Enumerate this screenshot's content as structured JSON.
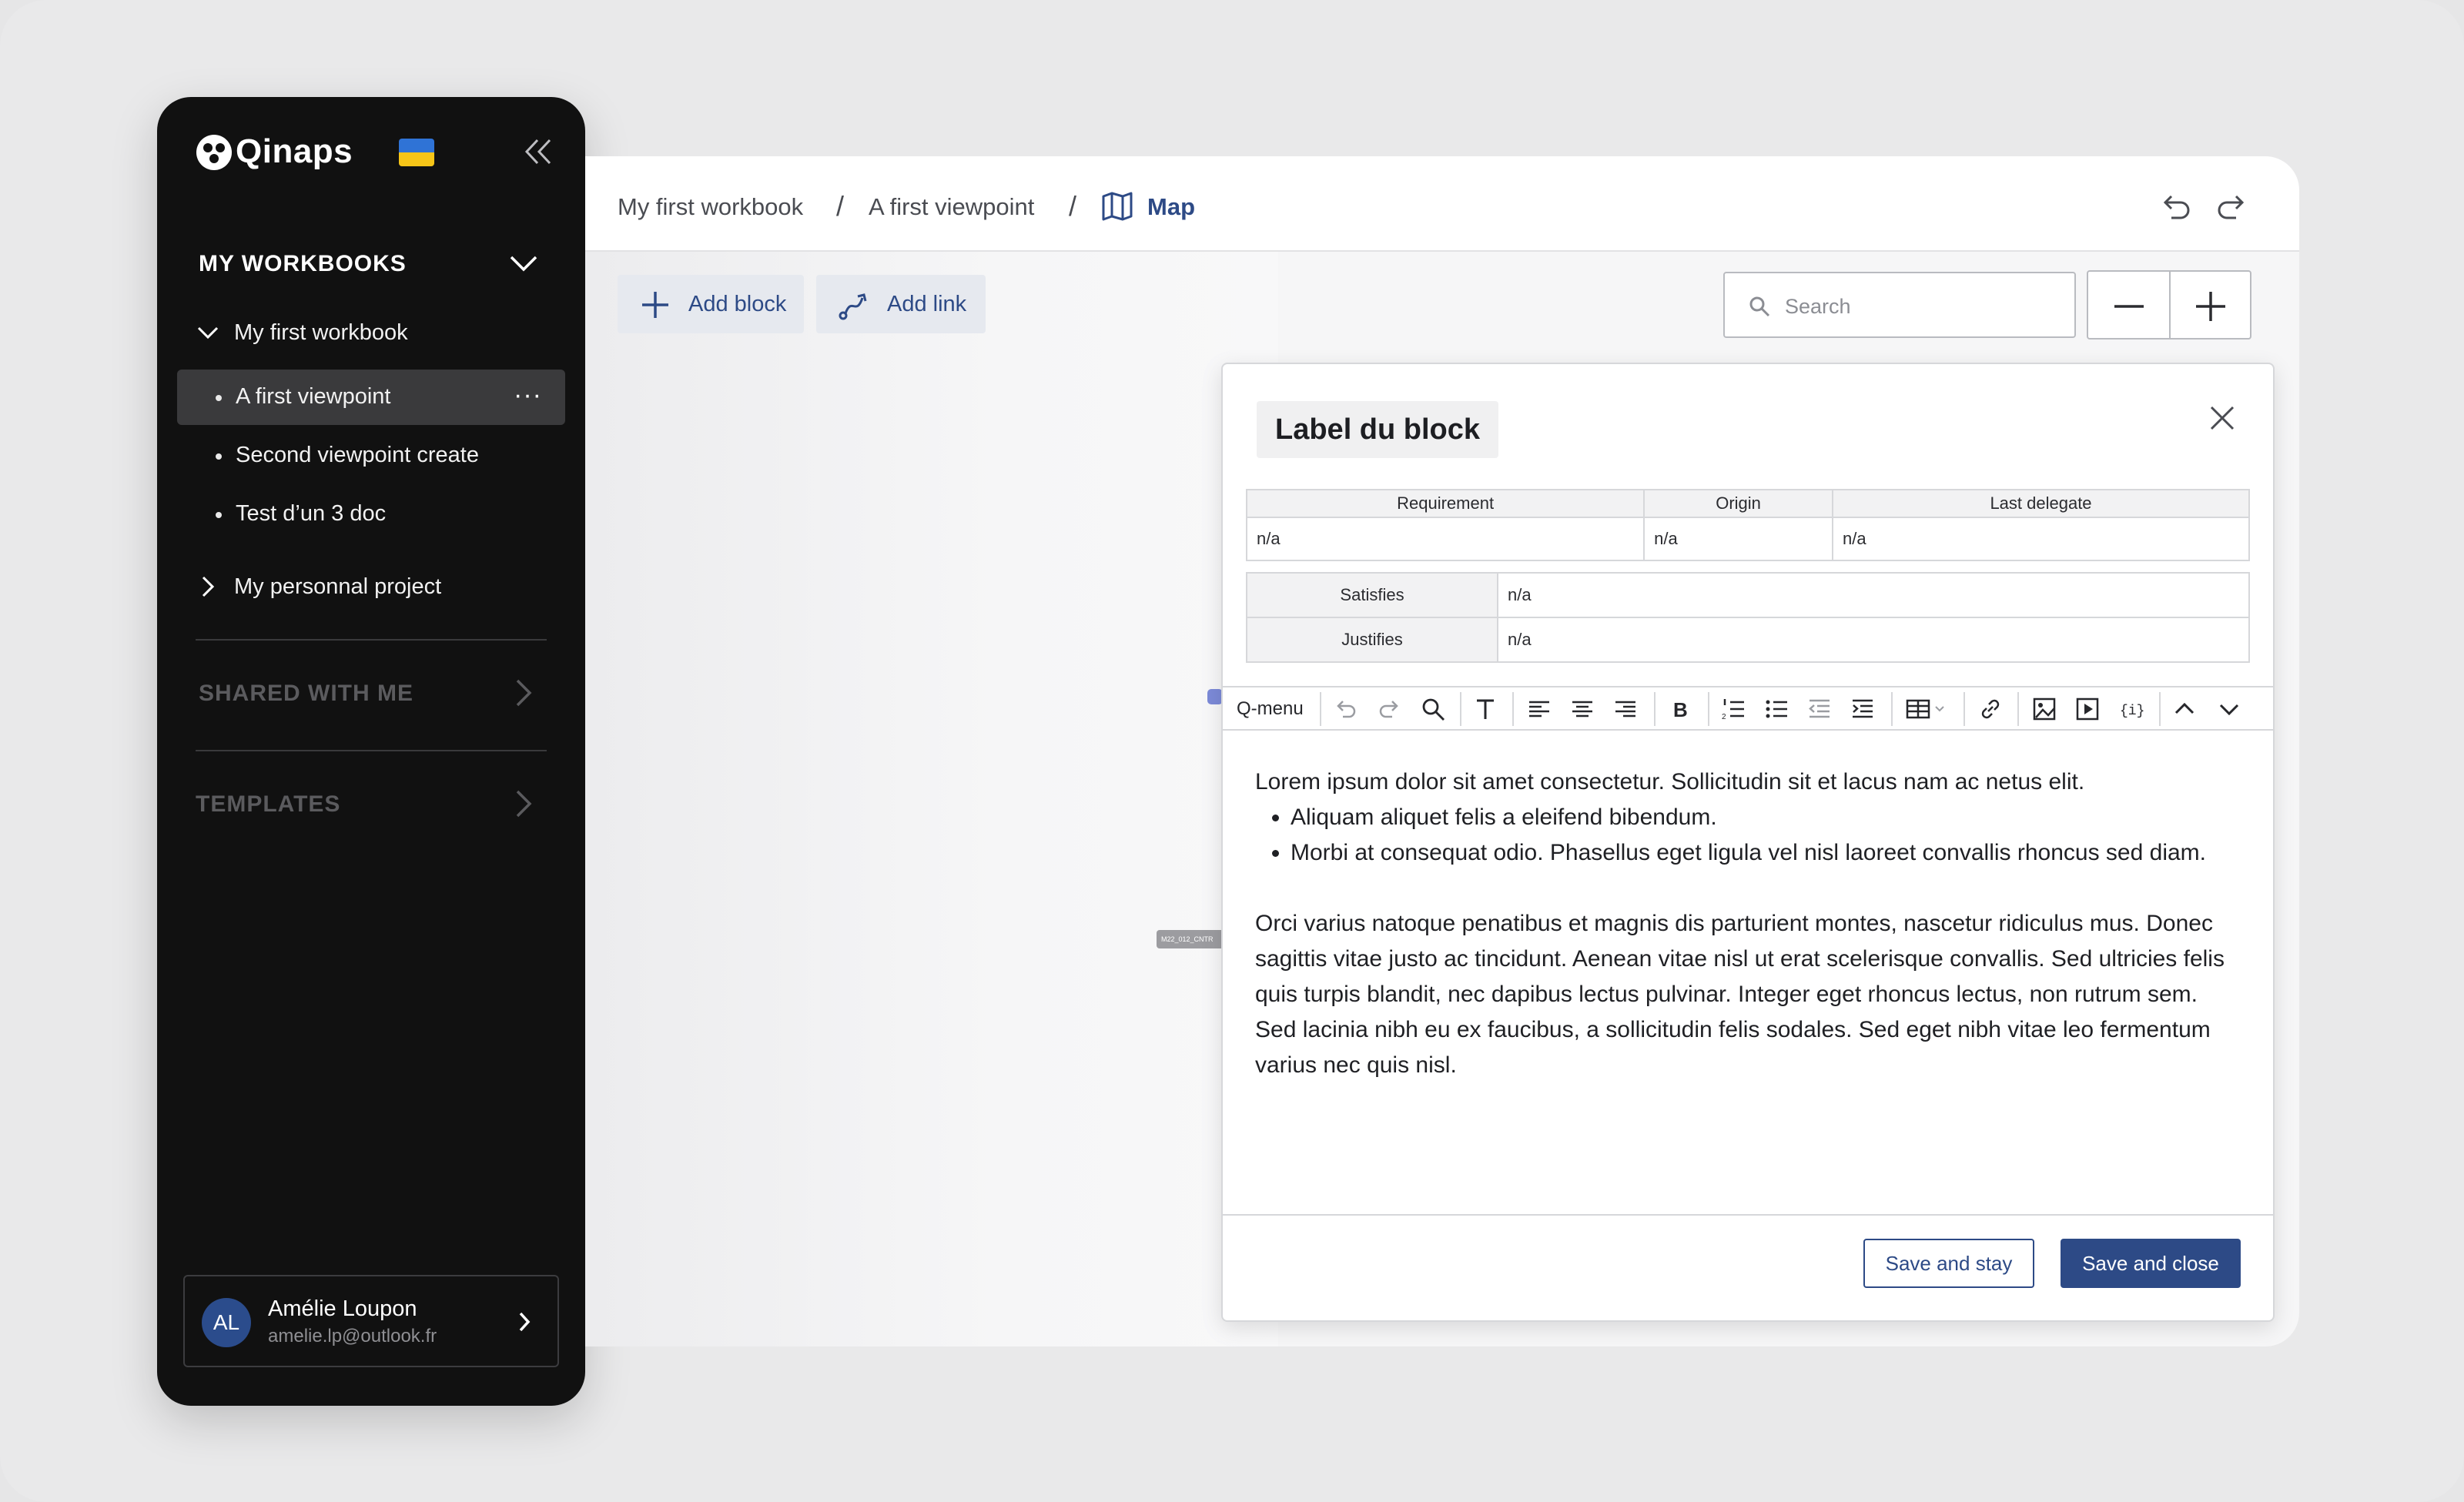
{
  "app": {
    "name": "Qinaps",
    "flag_icon": "ukraine-flag-icon"
  },
  "sidebar": {
    "collapse_icon": "double-chevron-left-icon",
    "my_workbooks": "MY WORKBOOKS",
    "workbooks": [
      {
        "label": "My first workbook",
        "expanded": true,
        "viewpoints": [
          {
            "label": "A first viewpoint",
            "active": true,
            "more": "···"
          },
          {
            "label": "Second viewpoint create"
          },
          {
            "label": "Test d’un 3 doc"
          }
        ]
      },
      {
        "label": "My personnal project",
        "expanded": false
      }
    ],
    "shared_with_me": "SHARED WITH ME",
    "templates": "TEMPLATES",
    "user": {
      "initials": "AL",
      "name": "Amélie Loupon",
      "email": "amelie.lp@outlook.fr"
    }
  },
  "breadcrumb": {
    "workbook": "My first workbook",
    "viewpoint": "A first viewpoint",
    "separator": "/",
    "view": "Map",
    "view_icon": "map-icon"
  },
  "toolbar": {
    "add_block": "Add block",
    "add_link": "Add link",
    "search_placeholder": "Search"
  },
  "canvas": {
    "node_label": "M22_012_CNTR"
  },
  "modal": {
    "title": "Label du block",
    "meta_headers": [
      "Requirement",
      "Origin",
      "Last delegate"
    ],
    "meta_values": [
      "n/a",
      "n/a",
      "n/a"
    ],
    "relations": [
      {
        "key": "Satisfies",
        "value": "n/a"
      },
      {
        "key": "Justifies",
        "value": "n/a"
      }
    ],
    "editor_toolbar": {
      "qmenu": "Q-menu"
    },
    "content": {
      "p1": "Lorem ipsum dolor sit amet consectetur. Sollicitudin sit et lacus nam ac netus elit.",
      "bullets": [
        "Aliquam aliquet felis a eleifend bibendum.",
        "Morbi at consequat odio. Phasellus eget ligula vel nisl laoreet convallis rhoncus sed diam."
      ],
      "p2": "Orci varius natoque penatibus et magnis dis parturient montes, nascetur ridiculus mus. Donec sagittis vitae justo ac tincidunt. Aenean vitae nisl ut erat scelerisque convallis. Sed ultricies felis quis turpis blandit, nec dapibus lectus pulvinar. Integer eget rhoncus lectus, non rutrum sem. Sed lacinia nibh eu ex faucibus, a sollicitudin felis sodales. Sed eget nibh vitae leo fermentum varius nec quis nisl."
    },
    "save_and_stay": "Save and stay",
    "save_and_close": "Save and close"
  },
  "colors": {
    "brand_blue": "#2d4a86",
    "sidebar_bg": "#111111",
    "active_item_bg": "#3a3a3c",
    "avatar_bg": "#2b4c8c"
  }
}
